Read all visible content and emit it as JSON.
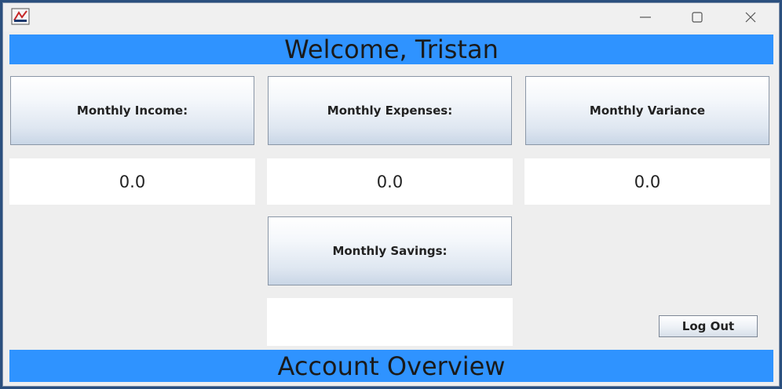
{
  "header": {
    "title": "Welcome, Tristan"
  },
  "cards": {
    "income": {
      "label": "Monthly Income:",
      "value": "0.0"
    },
    "expenses": {
      "label": "Monthly Expenses:",
      "value": "0.0"
    },
    "variance": {
      "label": "Monthly Variance",
      "value": "0.0"
    },
    "savings": {
      "label": "Monthly Savings:",
      "value": ""
    }
  },
  "actions": {
    "logout_label": "Log Out"
  },
  "footer": {
    "title": "Account Overview"
  },
  "icons": {
    "app": "java-app-icon",
    "minimize": "minimize-icon",
    "maximize": "maximize-icon",
    "close": "close-icon"
  },
  "colors": {
    "banner": "#2f93ff",
    "window_bg": "#eeeeee"
  }
}
